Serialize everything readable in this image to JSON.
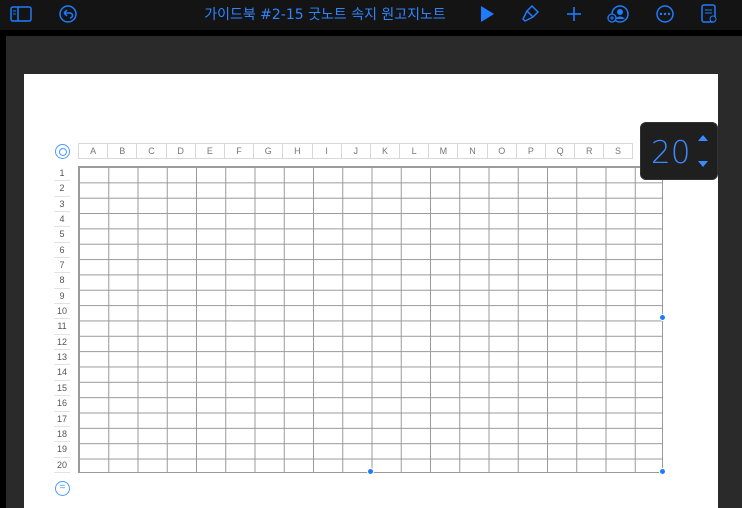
{
  "toolbar": {
    "title": "가이드북 #2-15 굿노트 속지 원고지노트",
    "icons": [
      "sidebar-icon",
      "undo-icon",
      "play-icon",
      "format-brush-icon",
      "add-icon",
      "collaborate-icon",
      "more-icon",
      "document-options-icon"
    ]
  },
  "table": {
    "columns": [
      "A",
      "B",
      "C",
      "D",
      "E",
      "F",
      "G",
      "H",
      "I",
      "J",
      "K",
      "L",
      "M",
      "N",
      "O",
      "P",
      "Q",
      "R",
      "S"
    ],
    "rows": [
      "1",
      "2",
      "3",
      "4",
      "5",
      "6",
      "7",
      "8",
      "9",
      "10",
      "11",
      "12",
      "13",
      "14",
      "15",
      "16",
      "17",
      "18",
      "19",
      "20"
    ]
  },
  "zoom": {
    "value": "20"
  },
  "colors": {
    "accent": "#1e7bff",
    "toolbar_bg": "#141414",
    "grid_line": "#9a9a9a"
  }
}
